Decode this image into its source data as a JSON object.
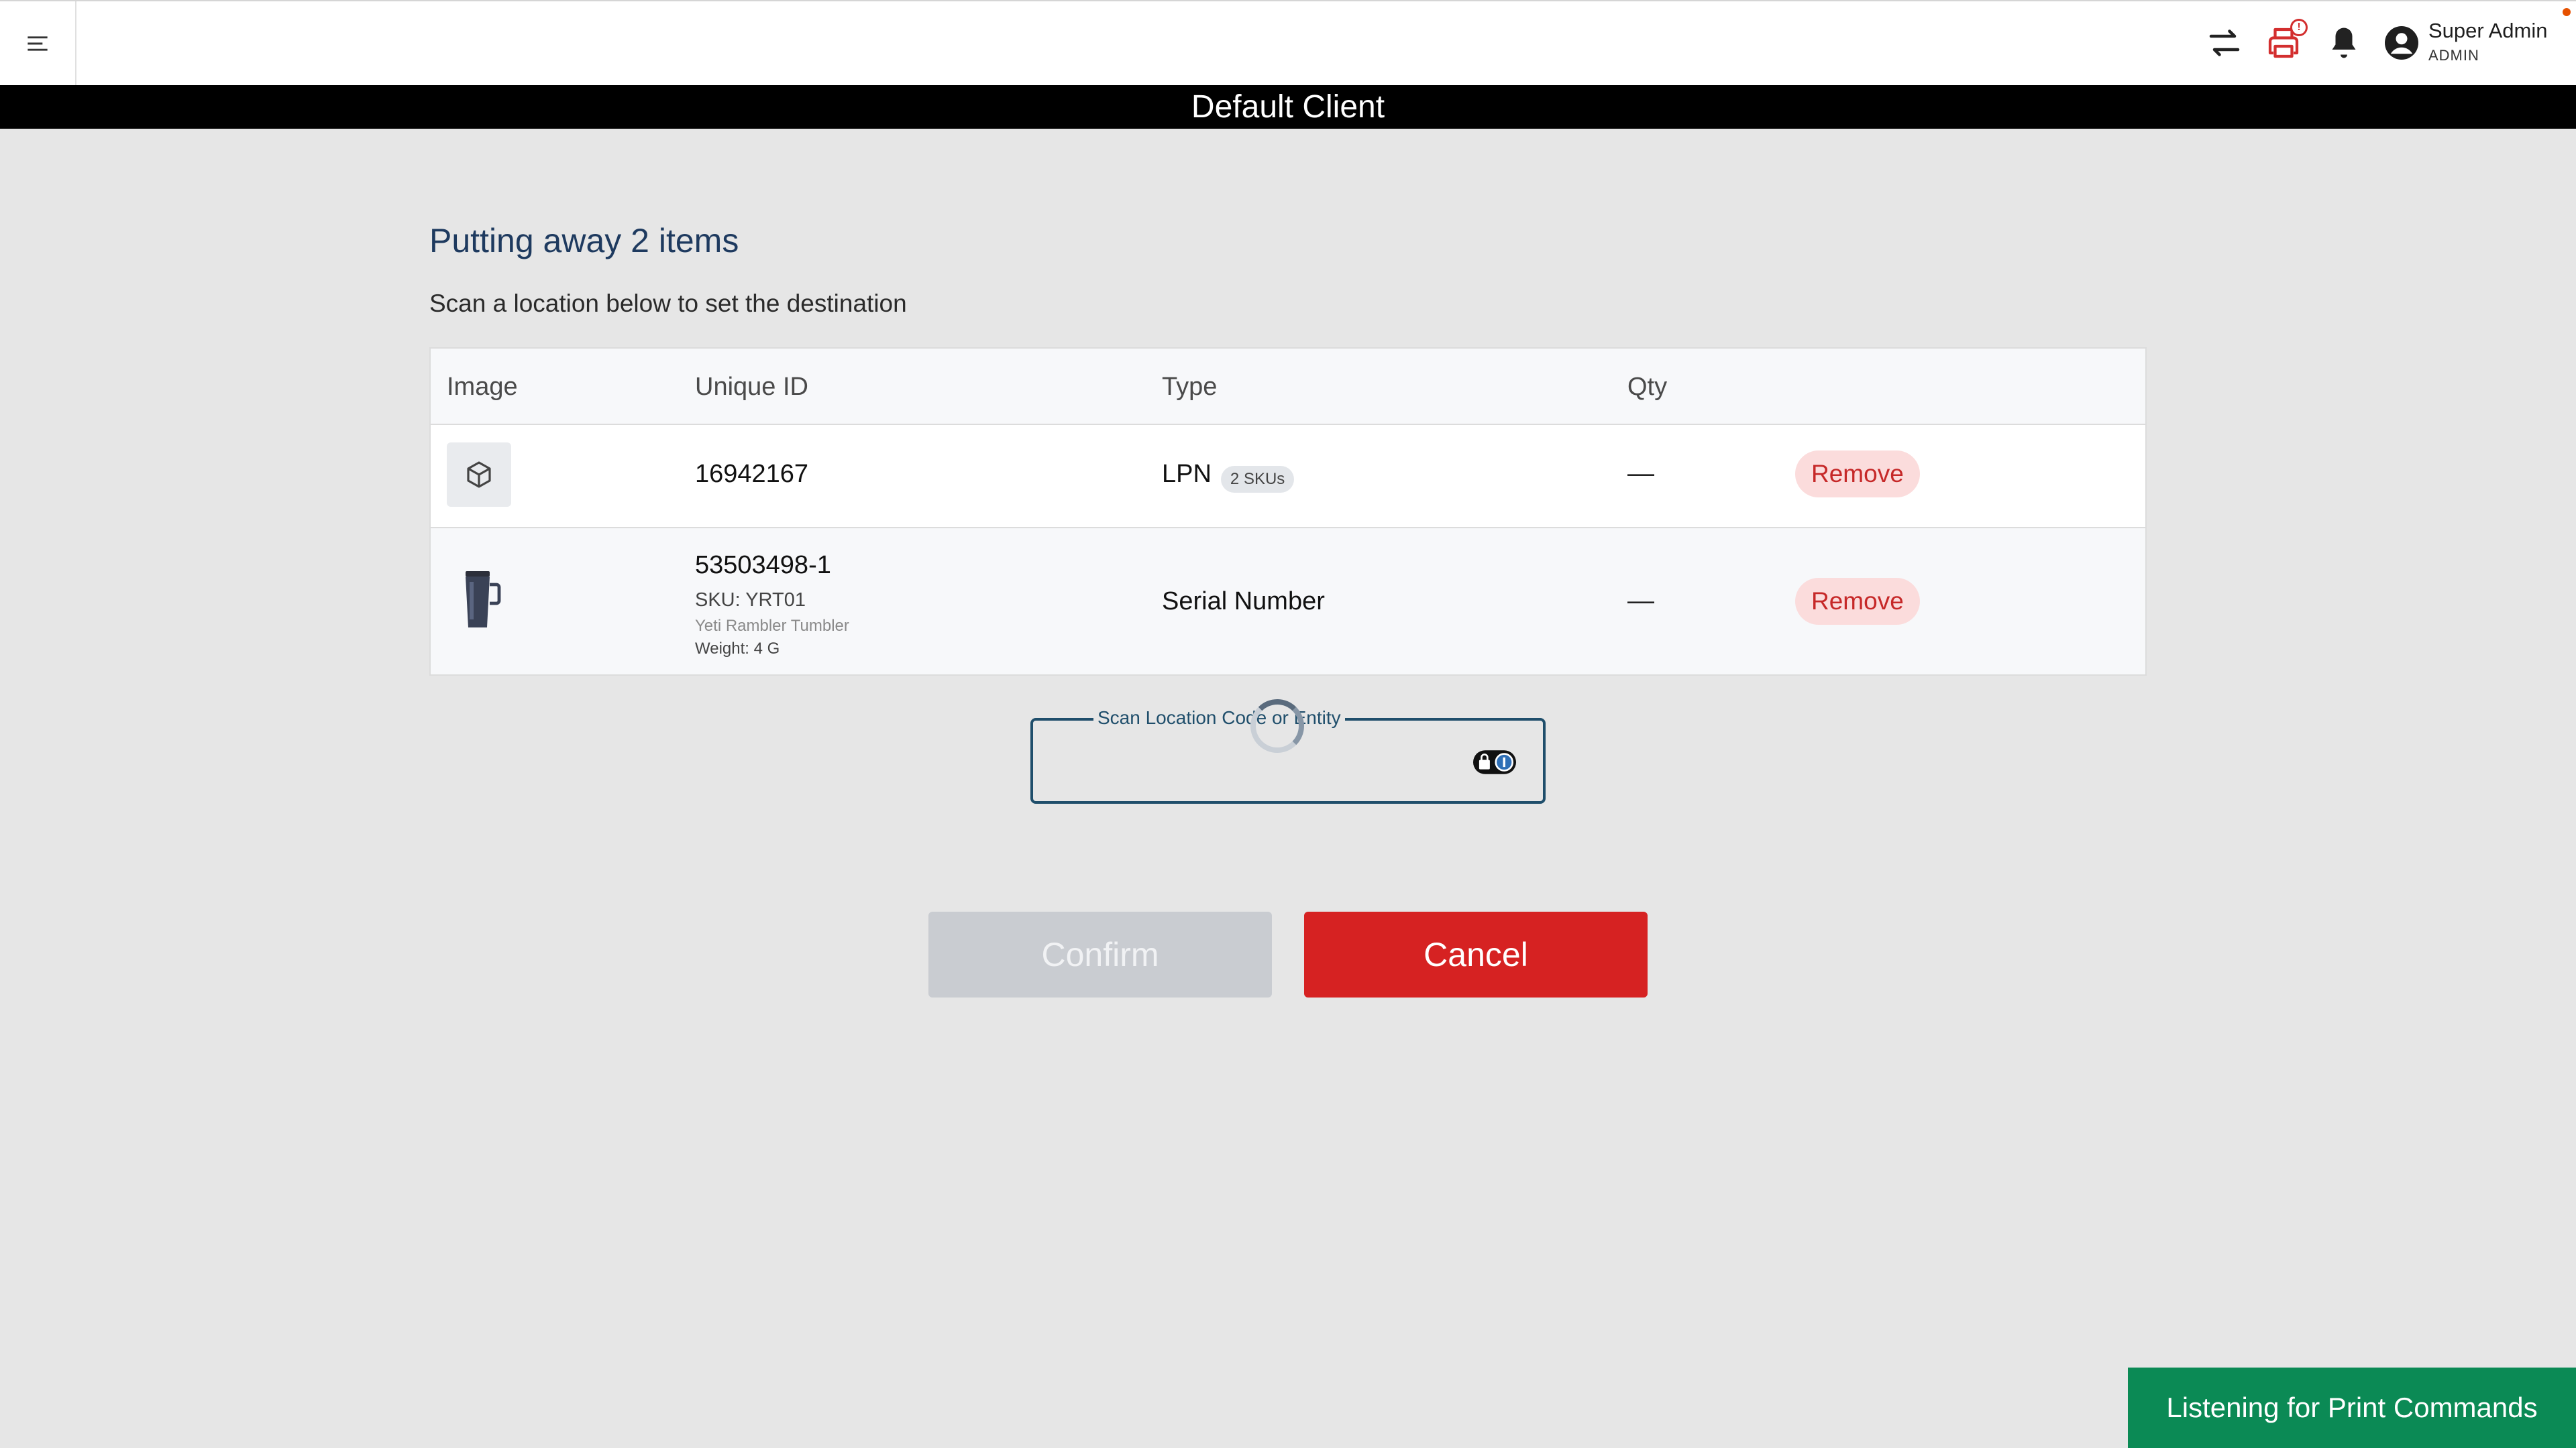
{
  "header": {
    "user_name": "Super Admin",
    "user_role": "ADMIN",
    "printer_badge": "!",
    "icons": [
      "menu-icon",
      "swap-arrows-icon",
      "printer-icon",
      "bell-icon",
      "account-circle-icon"
    ]
  },
  "client_bar": {
    "title": "Default Client"
  },
  "main": {
    "title": "Putting away 2 items",
    "subtitle": "Scan a location below to set the destination"
  },
  "table": {
    "columns": [
      "Image",
      "Unique ID",
      "Type",
      "Qty"
    ],
    "rows": [
      {
        "image_icon": "box-icon",
        "unique_id": "16942167",
        "type": "LPN",
        "type_badge": "2 SKUs",
        "qty": "—",
        "action": "Remove"
      },
      {
        "image_icon": "tumbler-image",
        "unique_id": "53503498-1",
        "sku": "SKU: YRT01",
        "product_name": "Yeti Rambler Tumbler",
        "weight": "Weight: 4 G",
        "type": "Serial Number",
        "qty": "—",
        "action": "Remove"
      }
    ]
  },
  "scan": {
    "label": "Scan Location Code or Entity",
    "value": ""
  },
  "buttons": {
    "confirm": "Confirm",
    "cancel": "Cancel"
  },
  "toast": {
    "text": "Listening for Print Commands"
  },
  "colors": {
    "title": "#1e3a5f",
    "cancel": "#d62222",
    "confirm_disabled": "#c9ccd1",
    "remove_bg": "#fbdcdc",
    "remove_text": "#c62828",
    "toast": "#0b8a55"
  }
}
